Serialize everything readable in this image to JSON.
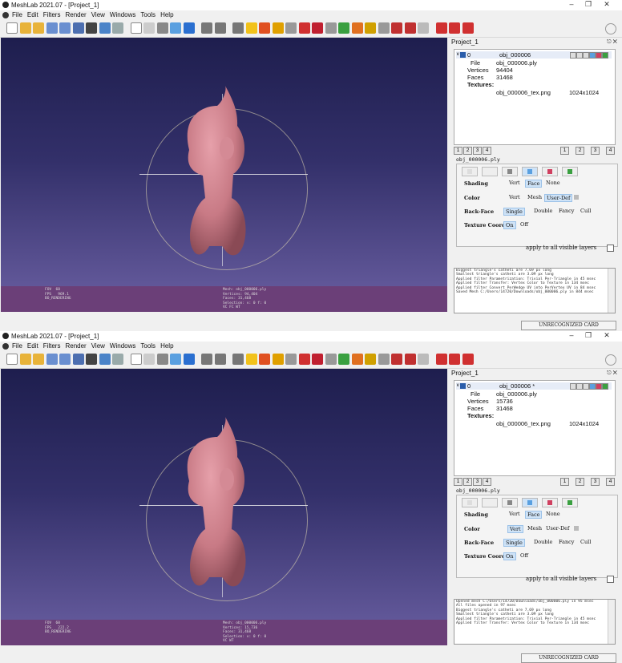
{
  "windows": [
    {
      "title": "MeshLab 2021.07 - [Project_1]",
      "menu": [
        "File",
        "Edit",
        "Filters",
        "Render",
        "View",
        "Windows",
        "Tools",
        "Help"
      ],
      "panel_title": "Project_1",
      "layer": {
        "num": "0",
        "name": "obj_000006"
      },
      "props": {
        "file_k": "File",
        "file_v": "obj_000006.ply",
        "vert_k": "Vertices",
        "vert_v": "94404",
        "face_k": "Faces",
        "face_v": "31468",
        "tex_k": "Textures:",
        "tex_name": "obj_000006_tex.png",
        "tex_size": "1024x1024"
      },
      "tab_nums_left": [
        "1",
        "2",
        "3",
        "4"
      ],
      "tab_nums_right": [
        "1",
        "2",
        "3",
        "4"
      ],
      "filename": "obj_000006.ply",
      "shading": {
        "label": "Shading",
        "opts": [
          "Vert",
          "Face",
          "None"
        ],
        "sel": 1
      },
      "color": {
        "label": "Color",
        "opts": [
          "Vert",
          "Mesh",
          "User-Def"
        ],
        "sel": 2
      },
      "backface": {
        "label": "Back-Face",
        "opts": [
          "Single",
          "Double",
          "Fancy",
          "Cull"
        ],
        "sel": 0
      },
      "texcoord": {
        "label": "Texture Coord",
        "opts": [
          "On",
          "Off"
        ],
        "sel": 0
      },
      "apply_all": "apply to all visible layers",
      "log": [
        "Biggest triangle's catheti are 7.69 px long",
        "Smallest triangle's catheti are 3.09 px long",
        "Applied filter Parametrization: Trivial Per-Triangle in 45 msec",
        "Applied filter Transfer: Vertex Color to Texture in 134 msec",
        "Applied filter Convert PerWedge UV into PerVertex UV in 84 msec",
        "Saved Mesh C:/Users/14720/Downloads/obj_000006.ply in 844 msec"
      ],
      "vp_left": "FOV  60\nFPS   969.1\nBO_RENDERING",
      "vp_right": "Mesh: obj_000006.ply\nVertices: 94,404\nFaces: 31,468\nSelection: v: 0 f: 0\nVC FC WT",
      "status": "UNRECOGNIZED CARD"
    },
    {
      "title": "MeshLab 2021.07 - [Project_1]",
      "menu": [
        "File",
        "Edit",
        "Filters",
        "Render",
        "View",
        "Windows",
        "Tools",
        "Help"
      ],
      "panel_title": "Project_1",
      "layer": {
        "num": "0",
        "name": "obj_000006 *"
      },
      "props": {
        "file_k": "File",
        "file_v": "obj_000006.ply",
        "vert_k": "Vertices",
        "vert_v": "15736",
        "face_k": "Faces",
        "face_v": "31468",
        "tex_k": "Textures:",
        "tex_name": "obj_000006_tex.png",
        "tex_size": "1024x1024"
      },
      "tab_nums_left": [
        "1",
        "2",
        "3",
        "4"
      ],
      "tab_nums_right": [
        "1",
        "2",
        "3",
        "4"
      ],
      "filename": "obj_000006.ply",
      "shading": {
        "label": "Shading",
        "opts": [
          "Vert",
          "Face",
          "None"
        ],
        "sel": 1
      },
      "color": {
        "label": "Color",
        "opts": [
          "Vert",
          "Mesh",
          "User-Def"
        ],
        "sel": 0
      },
      "backface": {
        "label": "Back-Face",
        "opts": [
          "Single",
          "Double",
          "Fancy",
          "Cull"
        ],
        "sel": 0
      },
      "texcoord": {
        "label": "Texture Coord",
        "opts": [
          "On",
          "Off"
        ],
        "sel": 0
      },
      "apply_all": "apply to all visible layers",
      "log": [
        "Opened mesh C:/Users/14720/Downloads/obj_000006.ply in 95 msec",
        "All files opened in 97 msec",
        "Biggest triangle's catheti are 7.69 px long",
        "Smallest triangle's catheti are 3.09 px long",
        "Applied filter Parametrization: Trivial Per-Triangle in 45 msec",
        "Applied filter Transfer: Vertex Color to Texture in 134 msec"
      ],
      "vp_left": "FOV  60\nFPS   222.2\nBO_RENDERING",
      "vp_right": "Mesh: obj_000006.ply\nVertices: 15,736\nFaces: 31,468\nSelection: v: 0 f: 0\nVC WT",
      "status": "UNRECOGNIZED CARD"
    }
  ],
  "colors": {
    "model": "#c87a85",
    "viewport_top": "#1e1e4e",
    "viewport_bottom": "#6a5fa2",
    "footer": "#6b3f78",
    "accent": "#2a5dab"
  }
}
